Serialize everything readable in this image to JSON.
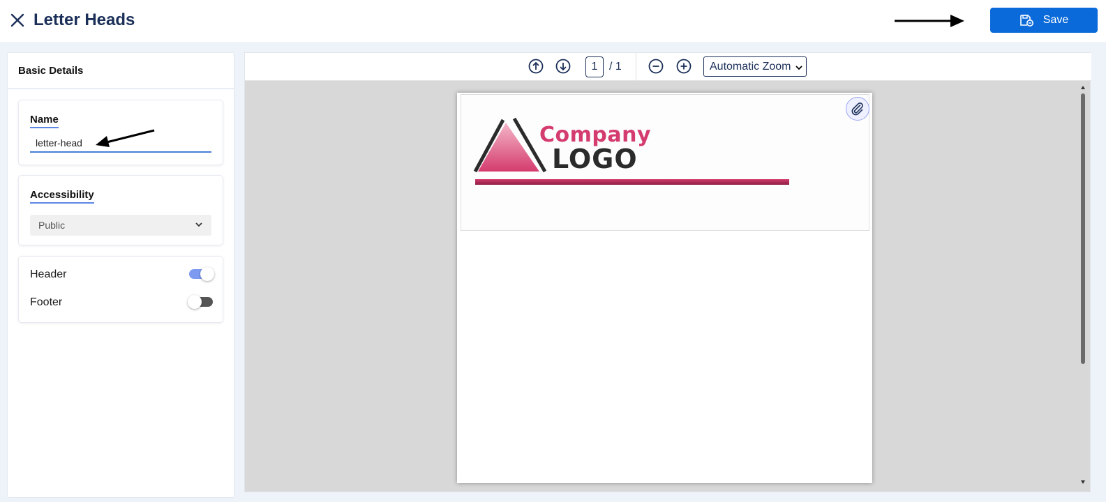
{
  "header": {
    "title": "Letter Heads",
    "save_label": "Save"
  },
  "sidebar": {
    "panel_title": "Basic Details",
    "name_label": "Name",
    "name_value": "letter-head",
    "accessibility_label": "Accessibility",
    "accessibility_value": "Public",
    "header_toggle_label": "Header",
    "header_toggle_on": true,
    "footer_toggle_label": "Footer",
    "footer_toggle_on": false
  },
  "viewer": {
    "current_page": "1",
    "total_pages": "/ 1",
    "zoom": "Automatic Zoom"
  },
  "letterhead": {
    "logo_company": "Company",
    "logo_text": "LOGO",
    "accent_color": "#d43c6e"
  },
  "colors": {
    "primary": "#0b6ad9",
    "title": "#1b2f58"
  }
}
